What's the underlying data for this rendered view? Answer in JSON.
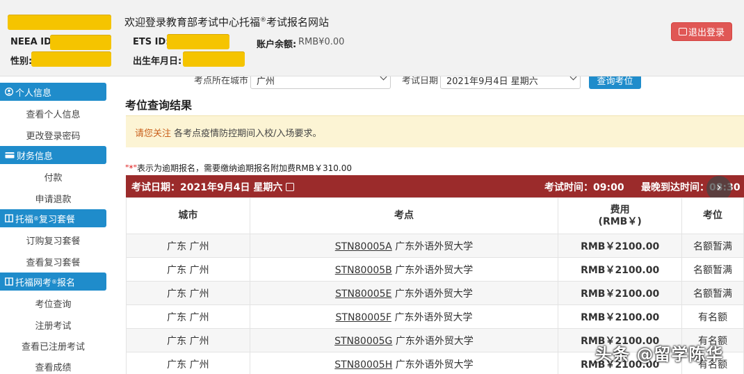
{
  "header": {
    "welcome": "欢迎登录教育部考试中心托福",
    "welcome_reg": "®",
    "welcome_tail": "考试报名网站",
    "neea_label": "NEEA ID:",
    "gender_label": "性别:",
    "ets_label": "ETS ID:",
    "dob_label": "出生年月日:",
    "balance_label": "账户余额:",
    "balance_value": "RMB¥0.00",
    "logout": "退出登录",
    "redact_color": "#f5c400"
  },
  "sidebar": {
    "sections": [
      {
        "label": "个人信息",
        "icon": "user-circle-icon",
        "items": [
          "查看个人信息",
          "更改登录密码"
        ]
      },
      {
        "label": "财务信息",
        "icon": "credit-card-icon",
        "items": [
          "付款",
          "申请退款"
        ]
      },
      {
        "label": "托福",
        "reg": "®",
        "tail": "复习套餐",
        "icon": "book-icon",
        "items": [
          "订购复习套餐",
          "查看复习套餐"
        ]
      },
      {
        "label": "托福网考",
        "reg": "®",
        "tail": "报名",
        "icon": "book-icon",
        "items": [
          "考位查询",
          "注册考试",
          "查看已注册考试",
          "查看成绩"
        ]
      }
    ]
  },
  "search": {
    "city_label": "考点所在城市",
    "city_value": "广州",
    "date_label": "考试日期",
    "date_value": "2021年9月4日 星期六",
    "button": "查询考位"
  },
  "results": {
    "title": "考位查询结果",
    "notice_hi": "请您关注",
    "notice_text": "各考点疫情防控期间入校/入场要求。",
    "note_star": "\"*\"",
    "note_text": "表示为逾期报名，需要缴纳逾期报名附加费RMB￥310.00",
    "bar_date": "考试日期：2021年9月4日 星期六",
    "bar_time": "考试时间：09:00",
    "bar_arrive": "最晚到达时间：08:30",
    "columns": [
      "城市",
      "考点",
      "费用",
      "(RMB￥)",
      "考位"
    ],
    "rows": [
      {
        "city": "广东 广州",
        "code": "STN80005A",
        "center": "广东外语外贸大学",
        "fee": "RMB￥2100.00",
        "seat": "名额暂满"
      },
      {
        "city": "广东 广州",
        "code": "STN80005B",
        "center": "广东外语外贸大学",
        "fee": "RMB￥2100.00",
        "seat": "名额暂满"
      },
      {
        "city": "广东 广州",
        "code": "STN80005E",
        "center": "广东外语外贸大学",
        "fee": "RMB￥2100.00",
        "seat": "名额暂满"
      },
      {
        "city": "广东 广州",
        "code": "STN80005F",
        "center": "广东外语外贸大学",
        "fee": "RMB￥2100.00",
        "seat": "有名额"
      },
      {
        "city": "广东 广州",
        "code": "STN80005G",
        "center": "广东外语外贸大学",
        "fee": "RMB￥2100.00",
        "seat": "有名额"
      },
      {
        "city": "广东 广州",
        "code": "STN80005H",
        "center": "广东外语外贸大学",
        "fee": "RMB￥2100.00",
        "seat": "有名额"
      }
    ]
  },
  "watermark": "头条 @留学陈华"
}
